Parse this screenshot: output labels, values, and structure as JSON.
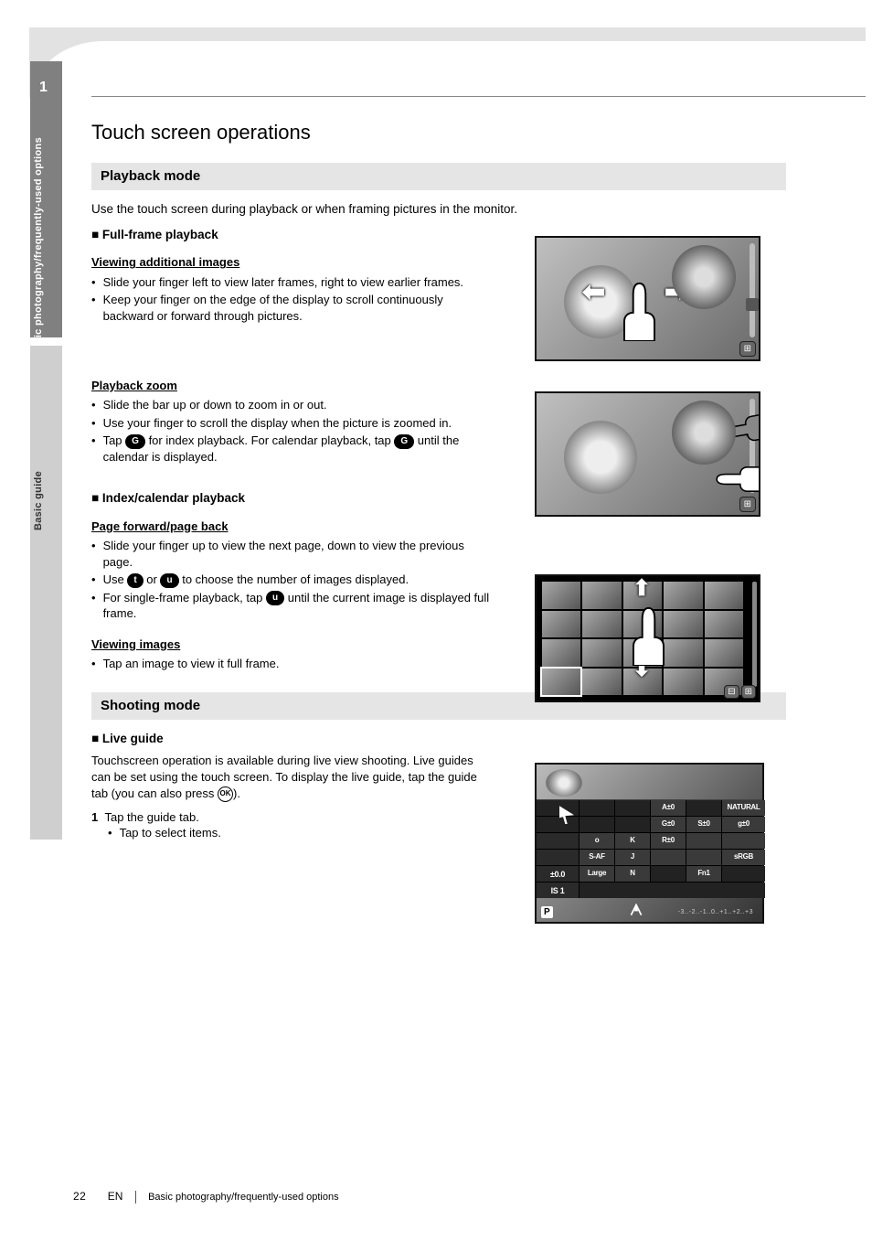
{
  "side": {
    "num": "1",
    "top_label": "Basic photography/frequently-used options",
    "bottom_label": "Basic guide"
  },
  "title": "Touch screen operations",
  "section1": {
    "heading": "Playback mode",
    "intro": "Use the touch screen during playback or when framing pictures in the monitor.",
    "fullframe": {
      "heading": "Full-frame playback",
      "viewing_add": {
        "label": "Viewing additional images",
        "b1": "Slide your finger left to view later frames, right to view earlier frames.",
        "b2": "Keep your finger on the edge of the display to scroll continuously backward or forward through pictures."
      },
      "zoom": {
        "label": "Playback zoom",
        "b1": "Slide the bar up or down to zoom in or out.",
        "b2": "Use your finger to scroll the display when the picture is zoomed in.",
        "b3_pre": "Tap",
        "b3_post": "for index playback. For calendar playback, tap",
        "b3_end": "until the calendar is displayed.",
        "icon": "G"
      }
    },
    "index": {
      "heading": "Index/calendar playback",
      "pages": {
        "label": "Page forward/page back",
        "b1": "Slide your finger up to view the next page, down to view the previous page.",
        "b2_pre": "Use",
        "b2_mid": "or",
        "b2_post": "to choose the number of images displayed.",
        "b3_pre": "For single-frame playback, tap",
        "b3_post": "until the current image is displayed full frame.",
        "icon_minus": "t",
        "icon_plus": "u"
      },
      "viewing": {
        "label": "Viewing images",
        "b1": "Tap an image to view it full frame."
      }
    }
  },
  "section2": {
    "heading": "Shooting mode",
    "live": {
      "heading": "Live guide",
      "p1_pre": "Touchscreen operation is available during live view shooting. Live guides can be set using the touch screen. To display the live guide, tap the guide tab (you can also press",
      "p1_post": ").",
      "ok_label": "OK",
      "step1_num": "1",
      "step1": "Tap the guide tab.",
      "step1_sub": "Tap to select items."
    }
  },
  "scp": {
    "r1c1": "",
    "r1c2": "",
    "r1c3": "",
    "r1c4": "A±0",
    "r1c5": "",
    "r1c6": "NATURAL",
    "r2c1": "",
    "r2c2": "",
    "r2c3": "",
    "r2c4": "G±0",
    "r2c5": "S±0",
    "r2c6": "g±0",
    "r3c1": "",
    "r3c2": "o",
    "r3c3": "K",
    "r3c4": "R±0",
    "r3c5": "",
    "r3c6": "",
    "r4c1": "",
    "r4c2": "S-AF",
    "r4c3": "J",
    "r4c4": "",
    "r4c5": "",
    "r4c6": "sRGB",
    "r5c1": "±0.0",
    "r5c2": "Large",
    "r5c3": "N",
    "r5c4": "",
    "r5c5": "Fn1",
    "r5c6": "",
    "r6c1": "IS 1",
    "r6c2": "",
    "r6c3": "",
    "r6c4": "",
    "r6c5": "",
    "r6c6": "",
    "p_badge": "P",
    "meter": "-3..-2..-1..0..+1..+2..+3"
  },
  "footer": {
    "page": "22",
    "lang": "EN",
    "chapter": "Basic photography/frequently-used options"
  }
}
